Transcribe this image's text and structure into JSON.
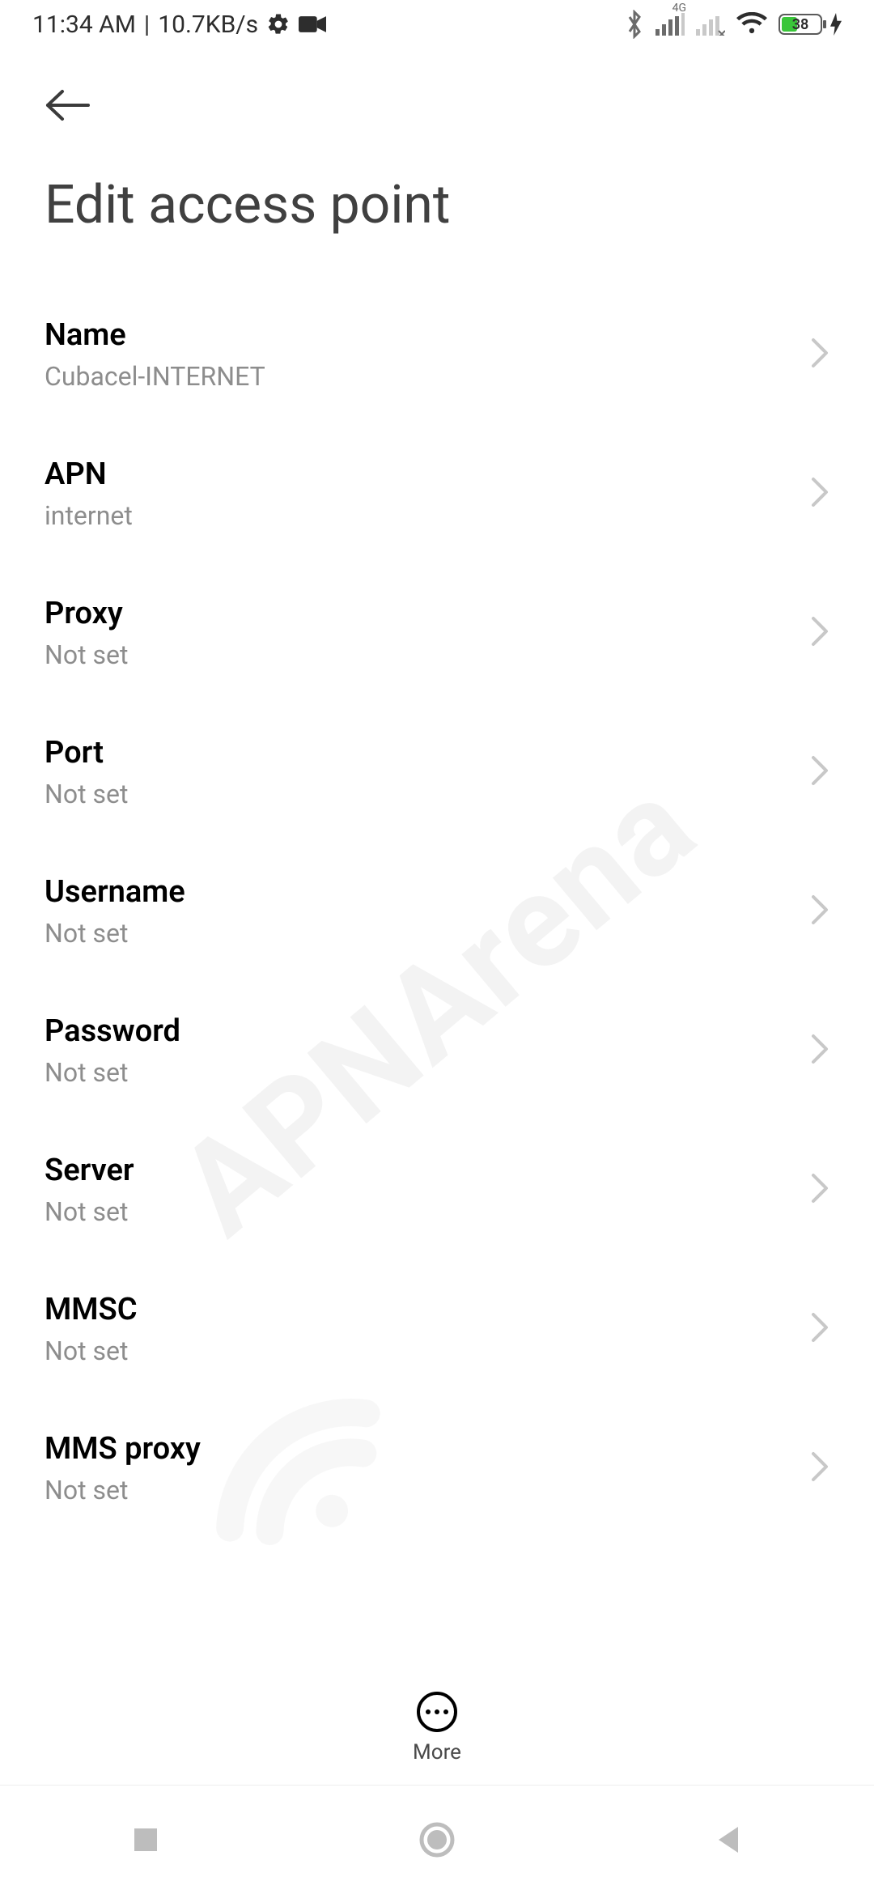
{
  "status": {
    "time": "11:34 AM",
    "net_speed": "10.7KB/s",
    "battery_pct": "38",
    "signal1_tech": "4G"
  },
  "header": {
    "title": "Edit access point"
  },
  "rows": [
    {
      "label": "Name",
      "value": "Cubacel-INTERNET"
    },
    {
      "label": "APN",
      "value": "internet"
    },
    {
      "label": "Proxy",
      "value": "Not set"
    },
    {
      "label": "Port",
      "value": "Not set"
    },
    {
      "label": "Username",
      "value": "Not set"
    },
    {
      "label": "Password",
      "value": "Not set"
    },
    {
      "label": "Server",
      "value": "Not set"
    },
    {
      "label": "MMSC",
      "value": "Not set"
    },
    {
      "label": "MMS proxy",
      "value": "Not set"
    }
  ],
  "bottom": {
    "more": "More"
  },
  "watermark": "APNArena"
}
